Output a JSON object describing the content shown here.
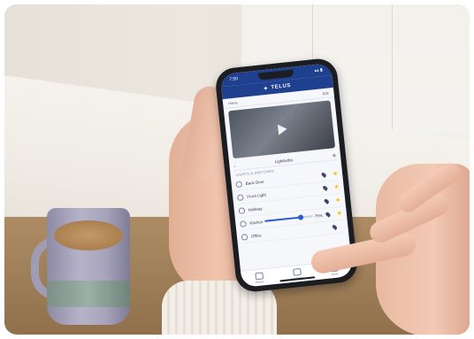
{
  "status_bar": {
    "time": "7:50",
    "signal": "▴▴ ▮"
  },
  "app": {
    "brand": "TELUS",
    "brand_icon": "telus-leaf-icon"
  },
  "sub_header": {
    "left": "Home",
    "right": "Edit"
  },
  "room": {
    "label": "Lightbulbs"
  },
  "section": {
    "label": "LIGHTS & SWITCHES"
  },
  "devices": [
    {
      "name": "Back Door"
    },
    {
      "name": "Front Light"
    },
    {
      "name": "Hallway"
    },
    {
      "name": "Kitchen",
      "dimmer_level": 0.75,
      "dimmer_value": "75%"
    },
    {
      "name": "Office"
    }
  ],
  "tabs": [
    {
      "label": "Home",
      "icon": "home-icon"
    },
    {
      "label": "Cameras",
      "icon": "camera-icon"
    },
    {
      "label": "More",
      "icon": "menu-icon"
    }
  ],
  "colors": {
    "accent": "#1f3f8f",
    "star": "#f2c21b",
    "slider": "#2c5ad1"
  }
}
